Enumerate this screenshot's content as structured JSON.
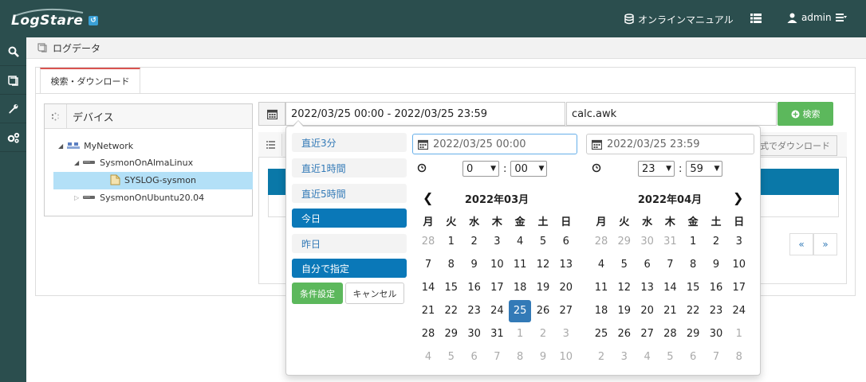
{
  "header": {
    "logo_text": "LogStare",
    "manual_label": "オンラインマニュアル",
    "user_label": "admin"
  },
  "breadcrumb": {
    "label": "ログデータ"
  },
  "tabs": [
    {
      "label": "検索・ダウンロード"
    }
  ],
  "device_panel": {
    "title": "デバイス",
    "tree": [
      {
        "label": "MyNetwork"
      },
      {
        "label": "SysmonOnAlmaLinux"
      },
      {
        "label": "SYSLOG-sysmon"
      },
      {
        "label": "SysmonOnUbuntu20.04"
      }
    ]
  },
  "search": {
    "range_value": "2022/03/25 00:00 - 2022/03/25 23:59",
    "script_value": "calc.awk",
    "search_label": "検索"
  },
  "result": {
    "download_label": "式でダウンロード",
    "pager": [
      "«",
      "»"
    ]
  },
  "picker": {
    "ranges": [
      {
        "label": "直近3分",
        "active": false
      },
      {
        "label": "直近1時間",
        "active": false
      },
      {
        "label": "直近5時間",
        "active": false
      },
      {
        "label": "今日",
        "active": true
      },
      {
        "label": "昨日",
        "active": false
      },
      {
        "label": "自分で指定",
        "active": true
      }
    ],
    "apply_label": "条件設定",
    "cancel_label": "キャンセル",
    "start": {
      "value": "2022/03/25 00:00",
      "hour": "0",
      "minute": "00"
    },
    "end": {
      "value": "2022/03/25 23:59",
      "hour": "23",
      "minute": "59"
    },
    "weekdays": [
      "月",
      "火",
      "水",
      "木",
      "金",
      "土",
      "日"
    ],
    "calendars": [
      {
        "title": "2022年03月",
        "weeks": [
          [
            "28",
            "1",
            "2",
            "3",
            "4",
            "5",
            "6"
          ],
          [
            "7",
            "8",
            "9",
            "10",
            "11",
            "12",
            "13"
          ],
          [
            "14",
            "15",
            "16",
            "17",
            "18",
            "19",
            "20"
          ],
          [
            "21",
            "22",
            "23",
            "24",
            "25",
            "26",
            "27"
          ],
          [
            "28",
            "29",
            "30",
            "31",
            "1",
            "2",
            "3"
          ],
          [
            "4",
            "5",
            "6",
            "7",
            "8",
            "9",
            "10"
          ]
        ]
      },
      {
        "title": "2022年04月",
        "weeks": [
          [
            "28",
            "29",
            "30",
            "31",
            "1",
            "2",
            "3"
          ],
          [
            "4",
            "5",
            "6",
            "7",
            "8",
            "9",
            "10"
          ],
          [
            "11",
            "12",
            "13",
            "14",
            "15",
            "16",
            "17"
          ],
          [
            "18",
            "19",
            "20",
            "21",
            "22",
            "23",
            "24"
          ],
          [
            "25",
            "26",
            "27",
            "28",
            "29",
            "30",
            "1"
          ],
          [
            "2",
            "3",
            "4",
            "5",
            "6",
            "7",
            "8"
          ]
        ]
      }
    ],
    "prev_symbol": "❮",
    "next_symbol": "❯"
  },
  "colors": {
    "header_bg": "#2b4e4e",
    "accent_blue": "#0a78b8",
    "success_green": "#5cb85c",
    "selected_day": "#337ab7"
  }
}
